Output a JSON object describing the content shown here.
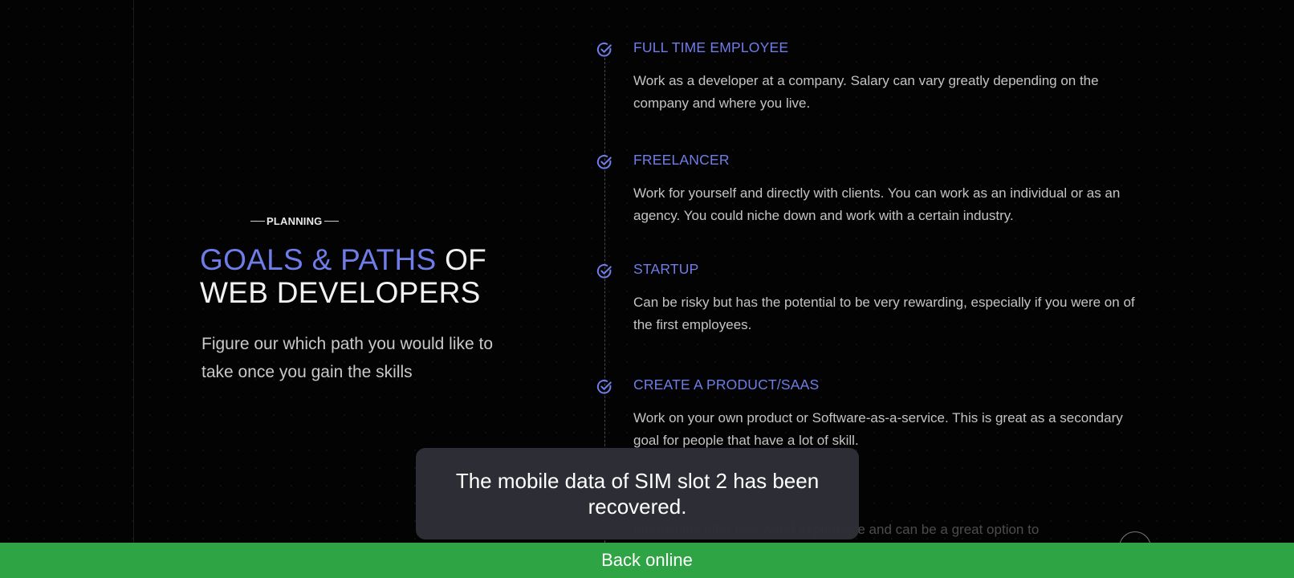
{
  "hero": {
    "eyebrow": "PLANNING",
    "title_accent": "GOALS & PATHS",
    "title_rest_1": " OF",
    "title_rest_2": "WEB DEVELOPERS",
    "subtitle": "Figure our which path you would like to take once you gain the skills",
    "accent_color": "#6f7de9"
  },
  "timeline": {
    "items": [
      {
        "icon": "check-circle-icon",
        "title": "FULL TIME EMPLOYEE",
        "description": "Work as a developer at a company. Salary can vary greatly depending on the company and where you live."
      },
      {
        "icon": "check-circle-icon",
        "title": "FREELANCER",
        "description": "Work for yourself and directly with clients. You can work as an individual or as an agency. You could niche down and work with a certain industry."
      },
      {
        "icon": "check-circle-icon",
        "title": "STARTUP",
        "description": "Can be risky but has the potential to be very rewarding, especially if you were on of the first employees."
      },
      {
        "icon": "check-circle-icon",
        "title": "CREATE A PRODUCT/SAAS",
        "description": "Work on your own product or Software-as-a-service. This is great as a secondary goal for people that have a lot of skill."
      },
      {
        "icon": "check-circle-icon",
        "title": "",
        "description": "Internships offer real-world experience and can be a great option to"
      }
    ]
  },
  "toast": {
    "message": "The mobile data of SIM slot 2 has been recovered."
  },
  "status_banner": {
    "text": "Back online",
    "color": "#2ea445"
  }
}
